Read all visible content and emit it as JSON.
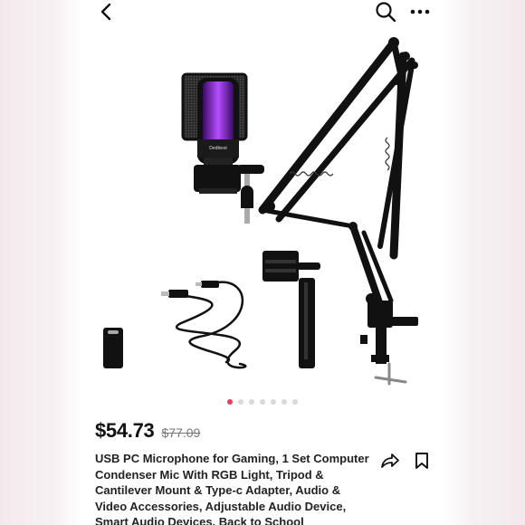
{
  "icons": {
    "back": "chevron-left-icon",
    "search": "search-icon",
    "more": "more-horizontal-icon",
    "share": "share-arrow-icon",
    "bookmark": "bookmark-icon"
  },
  "product": {
    "image_brand_text": "Dedikest",
    "carousel": {
      "total": 7,
      "active_index": 0
    },
    "price": "$54.73",
    "original_price": "$77.09",
    "title": "USB PC Microphone for Gaming, 1 Set Computer Condenser Mic With RGB Light, Tripod & Cantilever Mount & Type-c Adapter, Audio & Video Accessories, Adjustable Audio Device, Smart Audio Devices, Back to School"
  },
  "colors": {
    "accent_dot": "#e4405a",
    "inactive_dot": "#d9d9d9",
    "mic_glow": "#9b2bff"
  }
}
